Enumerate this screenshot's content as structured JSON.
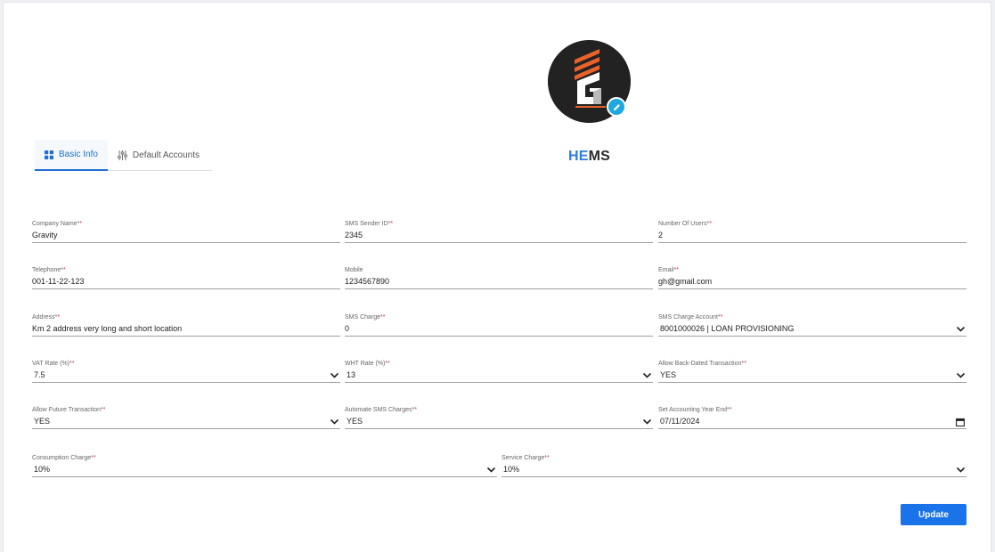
{
  "brand": {
    "highlight": "HE",
    "rest": "MS"
  },
  "logo": {
    "icon": "gravity-logo",
    "edit_icon": "pencil-icon"
  },
  "tabs": [
    {
      "label": "Basic Info",
      "icon": "grid-icon",
      "active": true
    },
    {
      "label": "Default Accounts",
      "icon": "sliders-icon",
      "active": false
    }
  ],
  "form": {
    "required_mark": "*",
    "fields": [
      {
        "label": "Company Name*",
        "value": "Gravity",
        "type": "text"
      },
      {
        "label": "SMS Sender ID*",
        "value": "2345",
        "type": "text"
      },
      {
        "label": "Number Of Users*",
        "value": "2",
        "type": "text"
      },
      {
        "label": "Telephone*",
        "value": "001-11-22-123",
        "type": "text"
      },
      {
        "label": "Mobile",
        "value": "1234567890",
        "type": "text"
      },
      {
        "label": "Email*",
        "value": "gh@gmail.com",
        "type": "text"
      },
      {
        "label": "Address*",
        "value": "Km 2 address very long and short location",
        "type": "text"
      },
      {
        "label": "SMS Charge*",
        "value": "0",
        "type": "text"
      },
      {
        "label": "SMS Charge Account*",
        "value": "8001000026 | LOAN PROVISIONING",
        "type": "select"
      },
      {
        "label": "VAT Rate (%)*",
        "value": "7.5",
        "type": "select"
      },
      {
        "label": "WHT Rate (%)*",
        "value": "13",
        "type": "select"
      },
      {
        "label": "Allow Back-Dated Transaction*",
        "value": "YES",
        "type": "select"
      },
      {
        "label": "Allow Future Transaction*",
        "value": "YES",
        "type": "select"
      },
      {
        "label": "Automate SMS Charges*",
        "value": "YES",
        "type": "select"
      },
      {
        "label": "Set Accounting Year End*",
        "value": "07/11/2024",
        "type": "date"
      },
      {
        "label": "Consumption Charge*",
        "value": "10%",
        "type": "select"
      },
      {
        "label": "Service Charge*",
        "value": "10%",
        "type": "select"
      }
    ]
  },
  "actions": {
    "update_label": "Update"
  },
  "colors": {
    "accent": "#1a73e8",
    "brand_highlight": "#2e7de0",
    "required": "#e03030",
    "logo_orange": "#e8622a"
  }
}
